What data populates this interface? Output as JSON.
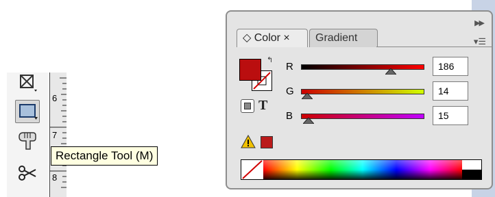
{
  "toolbar": {
    "tools": [
      {
        "icon": "reflect-tool-icon"
      },
      {
        "icon": "rectangle-tool-icon"
      },
      {
        "icon": "hand-tool-icon"
      },
      {
        "icon": "scissors-tool-icon"
      }
    ],
    "tooltip": "Rectangle Tool (M)"
  },
  "ruler": {
    "marks": [
      "6",
      "7",
      "8"
    ]
  },
  "color_panel": {
    "tabs": [
      {
        "label": "◇ Color ×",
        "active": true
      },
      {
        "label": "Gradient",
        "active": false
      }
    ],
    "fill_color": "#ba0e0f",
    "channels": [
      {
        "label": "R",
        "value": "186",
        "level": 0.73,
        "gradient": [
          "#000000",
          "#ff0000"
        ]
      },
      {
        "label": "G",
        "value": "14",
        "level": 0.05,
        "gradient": [
          "#cc0000",
          "#d0ff00"
        ]
      },
      {
        "label": "B",
        "value": "15",
        "level": 0.06,
        "gradient": [
          "#cc0000",
          "#c000ff"
        ]
      }
    ],
    "icons": [
      "swap-colors-icon",
      "fill-box-icon",
      "text-icon",
      "out-of-gamut-warning-icon",
      "panel-menu-icon",
      "collapse-panel-icon"
    ]
  }
}
